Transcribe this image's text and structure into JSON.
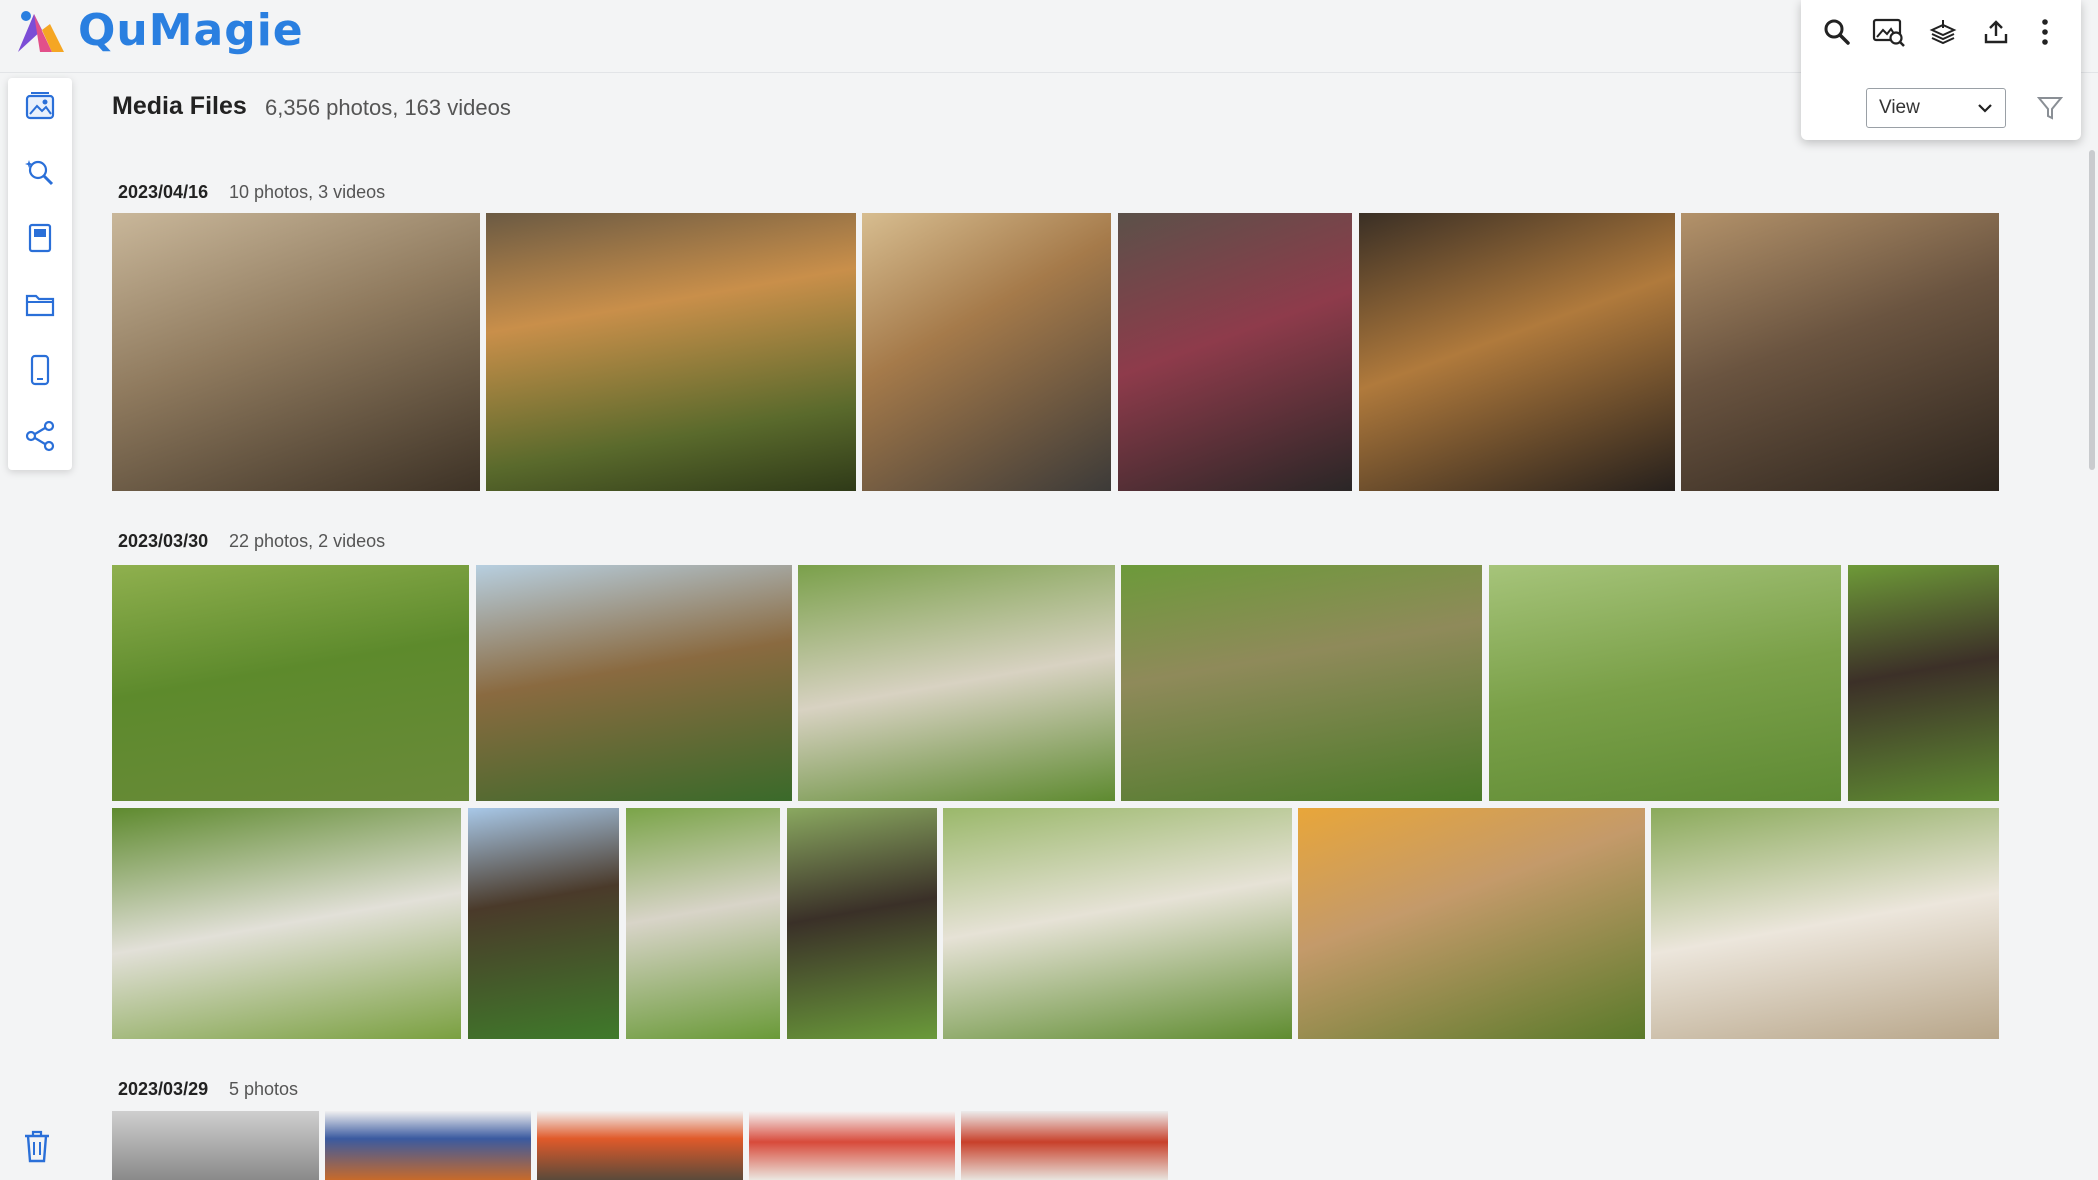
{
  "app": {
    "name": "QuMagie",
    "brand_color": "#2a7fe0"
  },
  "toolbar": {
    "icons": [
      "search-icon",
      "image-search-icon",
      "stack-icon",
      "upload-icon",
      "more-vertical-icon"
    ],
    "view_label": "View",
    "filter_icon": "filter-icon"
  },
  "sidebar": {
    "items": [
      "photos-icon",
      "smart-album-icon",
      "album-icon",
      "folder-icon",
      "mobile-device-icon",
      "share-icon"
    ],
    "trash_icon": "trash-icon"
  },
  "page": {
    "title": "Media Files",
    "count": "6,356 photos, 163 videos"
  },
  "groups": [
    {
      "date": "2023/04/16",
      "count": "10 photos, 3 videos"
    },
    {
      "date": "2023/03/30",
      "count": "22 photos, 2 videos"
    },
    {
      "date": "2023/03/29",
      "count": "5 photos"
    }
  ]
}
